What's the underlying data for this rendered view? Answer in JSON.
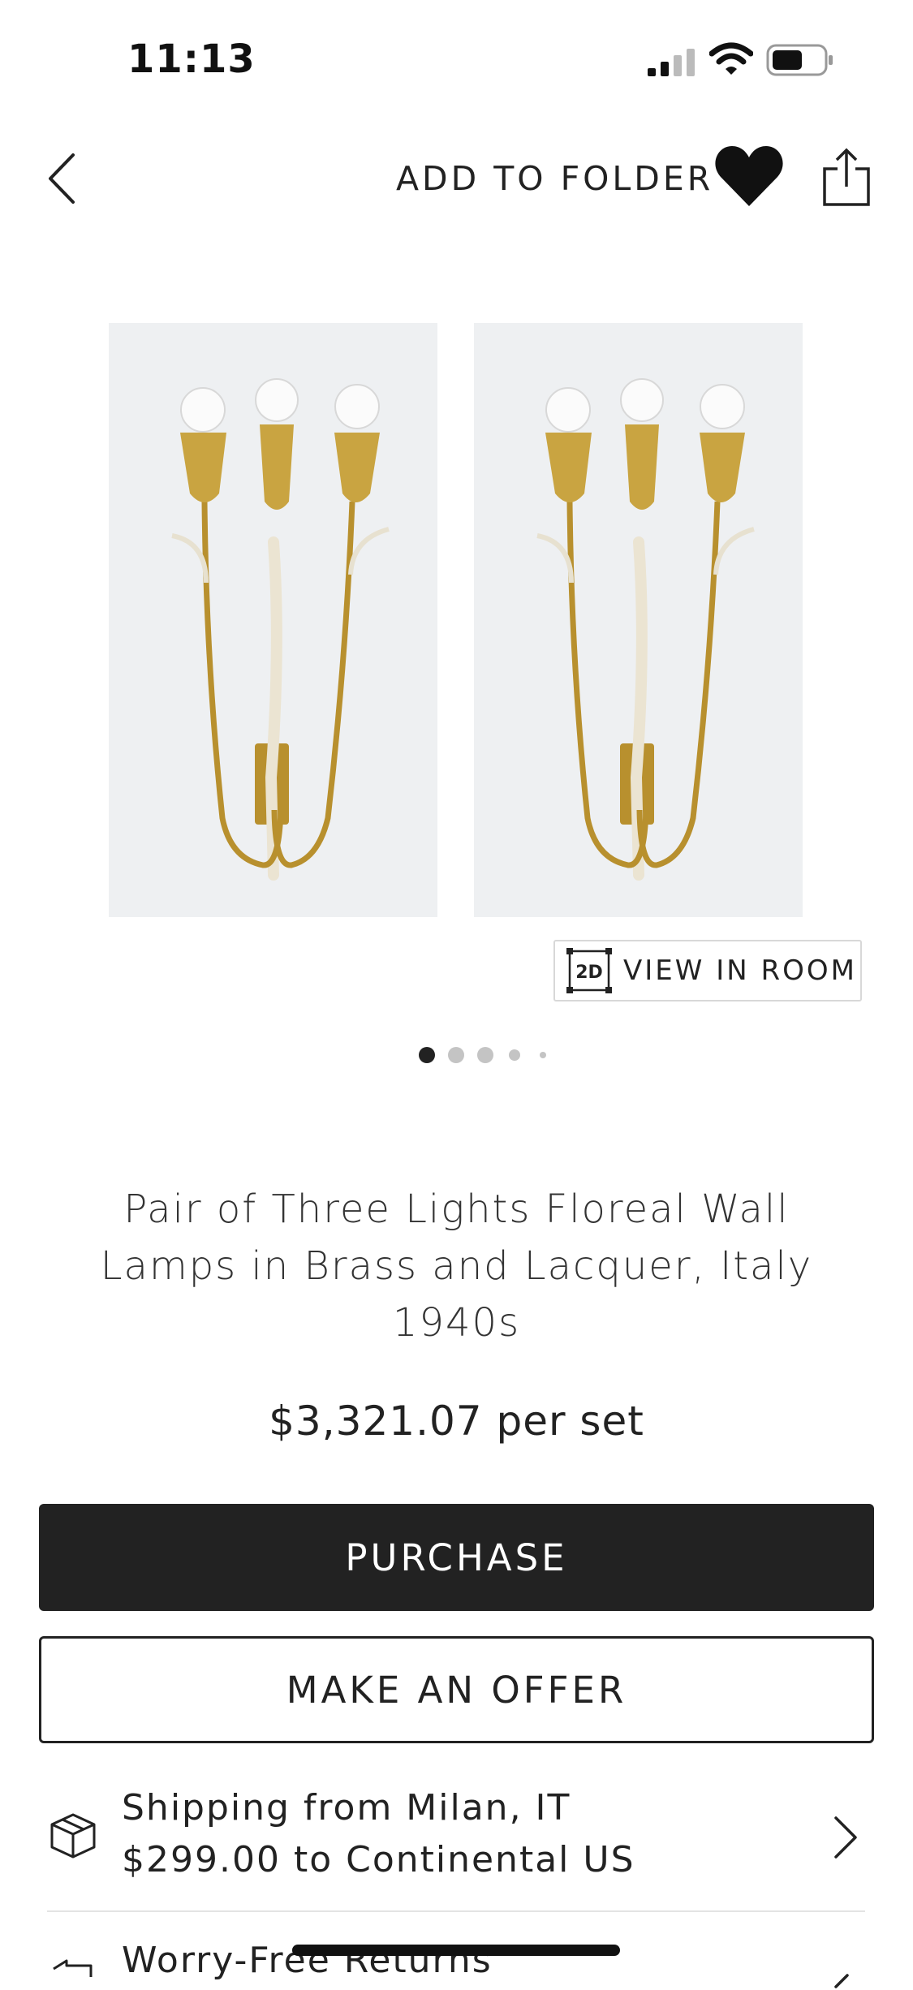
{
  "status_bar": {
    "time": "11:13",
    "signal_icon": "cellular-signal-icon",
    "wifi_icon": "wifi-icon",
    "battery_icon": "battery-icon"
  },
  "nav": {
    "back_icon": "chevron-left-icon",
    "add_to_folder_label": "ADD TO FOLDER",
    "favorite_icon": "heart-icon",
    "share_icon": "share-icon"
  },
  "carousel": {
    "images": [
      {
        "subject": "brass-wall-sconce"
      },
      {
        "subject": "brass-wall-sconce"
      }
    ],
    "view_in_room_badge": "2D",
    "view_in_room_label": "VIEW IN ROOM",
    "page_count": 5,
    "active_page": 1
  },
  "product": {
    "title": "Pair of Three Lights Floreal Wall Lamps in Brass and Lacquer, Italy 1940s",
    "price": "$3,321.07 per set"
  },
  "actions": {
    "purchase_label": "PURCHASE",
    "offer_label": "MAKE AN OFFER"
  },
  "shipping": {
    "icon": "package-icon",
    "line1": "Shipping from Milan, IT",
    "line2": "$299.00 to Continental US"
  },
  "returns": {
    "icon": "returns-icon",
    "label": "Worry-Free Returns"
  },
  "colors": {
    "primary": "#222222",
    "background": "#ffffff",
    "divider": "#e3e3e3"
  }
}
